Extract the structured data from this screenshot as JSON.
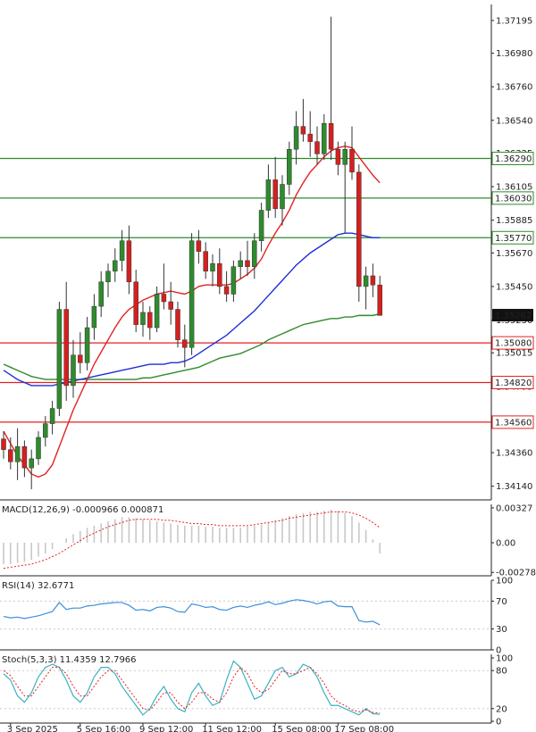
{
  "chart_data": {
    "type": "candlestick",
    "price_panel": {
      "y_ticks": [
        "1.37195",
        "1.36980",
        "1.36760",
        "1.36540",
        "1.36325",
        "1.36105",
        "1.35885",
        "1.35670",
        "1.35450",
        "1.35230",
        "1.35015",
        "1.34795",
        "1.34575",
        "1.34360",
        "1.34140"
      ],
      "ylim": [
        1.3405,
        1.373
      ],
      "current_price": "1.35262",
      "levels": [
        {
          "value": 1.3629,
          "label": "1.36290",
          "color": "#2e8b2e"
        },
        {
          "value": 1.3603,
          "label": "1.36030",
          "color": "#2e8b2e"
        },
        {
          "value": 1.3577,
          "label": "1.35770",
          "color": "#2e8b2e"
        },
        {
          "value": 1.3508,
          "label": "1.35080",
          "color": "#e32222"
        },
        {
          "value": 1.3482,
          "label": "1.34820",
          "color": "#e32222"
        },
        {
          "value": 1.3456,
          "label": "1.34560",
          "color": "#e32222"
        }
      ],
      "candles": [
        [
          1.3445,
          1.345,
          1.3432,
          1.3438
        ],
        [
          1.3438,
          1.3446,
          1.3425,
          1.343
        ],
        [
          1.343,
          1.3452,
          1.3418,
          1.344
        ],
        [
          1.344,
          1.3444,
          1.342,
          1.3426
        ],
        [
          1.3426,
          1.3438,
          1.3412,
          1.3432
        ],
        [
          1.3432,
          1.345,
          1.3428,
          1.3446
        ],
        [
          1.3446,
          1.346,
          1.344,
          1.3455
        ],
        [
          1.3455,
          1.347,
          1.3448,
          1.3465
        ],
        [
          1.3465,
          1.3535,
          1.346,
          1.353
        ],
        [
          1.353,
          1.3548,
          1.347,
          1.348
        ],
        [
          1.348,
          1.351,
          1.3472,
          1.35
        ],
        [
          1.35,
          1.3515,
          1.3488,
          1.3495
        ],
        [
          1.3495,
          1.3525,
          1.349,
          1.3518
        ],
        [
          1.3518,
          1.354,
          1.351,
          1.3532
        ],
        [
          1.3532,
          1.3555,
          1.3525,
          1.3548
        ],
        [
          1.3548,
          1.356,
          1.3538,
          1.3555
        ],
        [
          1.3555,
          1.357,
          1.3548,
          1.3562
        ],
        [
          1.3562,
          1.3582,
          1.3555,
          1.3575
        ],
        [
          1.3575,
          1.3585,
          1.354,
          1.3548
        ],
        [
          1.3548,
          1.3556,
          1.3515,
          1.352
        ],
        [
          1.352,
          1.3535,
          1.3512,
          1.3528
        ],
        [
          1.3528,
          1.3532,
          1.351,
          1.3518
        ],
        [
          1.3518,
          1.3545,
          1.3515,
          1.354
        ],
        [
          1.354,
          1.356,
          1.353,
          1.3535
        ],
        [
          1.3535,
          1.3548,
          1.352,
          1.353
        ],
        [
          1.353,
          1.3535,
          1.3505,
          1.351
        ],
        [
          1.351,
          1.352,
          1.3492,
          1.3505
        ],
        [
          1.3505,
          1.358,
          1.35,
          1.3575
        ],
        [
          1.3575,
          1.3582,
          1.356,
          1.3568
        ],
        [
          1.3568,
          1.3574,
          1.355,
          1.3555
        ],
        [
          1.3555,
          1.3566,
          1.3545,
          1.356
        ],
        [
          1.356,
          1.357,
          1.354,
          1.3545
        ],
        [
          1.3545,
          1.3555,
          1.3535,
          1.354
        ],
        [
          1.354,
          1.3562,
          1.3535,
          1.3558
        ],
        [
          1.3558,
          1.3568,
          1.355,
          1.3562
        ],
        [
          1.3562,
          1.3575,
          1.3552,
          1.3558
        ],
        [
          1.3558,
          1.358,
          1.355,
          1.3575
        ],
        [
          1.3575,
          1.36,
          1.3568,
          1.3595
        ],
        [
          1.3595,
          1.3625,
          1.359,
          1.3615
        ],
        [
          1.3615,
          1.363,
          1.359,
          1.3596
        ],
        [
          1.3596,
          1.3618,
          1.3585,
          1.3612
        ],
        [
          1.3612,
          1.364,
          1.3605,
          1.3635
        ],
        [
          1.3635,
          1.366,
          1.3625,
          1.365
        ],
        [
          1.365,
          1.3668,
          1.364,
          1.3645
        ],
        [
          1.3645,
          1.366,
          1.363,
          1.364
        ],
        [
          1.364,
          1.365,
          1.3625,
          1.3632
        ],
        [
          1.3632,
          1.3658,
          1.3628,
          1.3652
        ],
        [
          1.3652,
          1.3722,
          1.3628,
          1.3635
        ],
        [
          1.3635,
          1.364,
          1.3618,
          1.3625
        ],
        [
          1.3625,
          1.364,
          1.358,
          1.3635
        ],
        [
          1.3635,
          1.365,
          1.3615,
          1.362
        ],
        [
          1.362,
          1.3625,
          1.3535,
          1.3545
        ],
        [
          1.3545,
          1.3558,
          1.353,
          1.3552
        ],
        [
          1.3552,
          1.356,
          1.3538,
          1.3546
        ],
        [
          1.3546,
          1.3552,
          1.3526,
          1.3526
        ]
      ],
      "sma_fast_red": [
        1.345,
        1.3442,
        1.3434,
        1.3428,
        1.3422,
        1.342,
        1.3422,
        1.3428,
        1.344,
        1.3452,
        1.3464,
        1.3474,
        1.3484,
        1.3494,
        1.3502,
        1.351,
        1.3518,
        1.3525,
        1.353,
        1.3533,
        1.3536,
        1.3538,
        1.354,
        1.3541,
        1.3542,
        1.3541,
        1.354,
        1.3542,
        1.3545,
        1.3546,
        1.3546,
        1.3546,
        1.3546,
        1.3547,
        1.355,
        1.3553,
        1.3557,
        1.3563,
        1.3572,
        1.358,
        1.3587,
        1.3595,
        1.3605,
        1.3613,
        1.362,
        1.3625,
        1.363,
        1.3634,
        1.3636,
        1.3637,
        1.3636,
        1.363,
        1.3624,
        1.3618,
        1.3613
      ],
      "sma_mid_blue": [
        1.349,
        1.3487,
        1.3484,
        1.3482,
        1.348,
        1.348,
        1.348,
        1.348,
        1.3481,
        1.3482,
        1.3483,
        1.3484,
        1.3485,
        1.3486,
        1.3487,
        1.3488,
        1.3489,
        1.349,
        1.3491,
        1.3492,
        1.3493,
        1.3494,
        1.3494,
        1.3494,
        1.3495,
        1.3495,
        1.3496,
        1.3498,
        1.3501,
        1.3504,
        1.3507,
        1.351,
        1.3513,
        1.3517,
        1.3521,
        1.3525,
        1.3529,
        1.3534,
        1.3539,
        1.3544,
        1.3549,
        1.3554,
        1.3559,
        1.3563,
        1.3567,
        1.357,
        1.3573,
        1.3576,
        1.3579,
        1.358,
        1.358,
        1.3579,
        1.3578,
        1.3577,
        1.3577
      ],
      "sma_slow_green": [
        1.3494,
        1.3492,
        1.349,
        1.3488,
        1.3486,
        1.3485,
        1.3484,
        1.3484,
        1.3484,
        1.3484,
        1.3484,
        1.3484,
        1.3484,
        1.3484,
        1.3484,
        1.3484,
        1.3484,
        1.3484,
        1.3484,
        1.3484,
        1.3485,
        1.3485,
        1.3486,
        1.3487,
        1.3488,
        1.3489,
        1.349,
        1.3491,
        1.3492,
        1.3494,
        1.3496,
        1.3498,
        1.3499,
        1.35,
        1.3501,
        1.3503,
        1.3505,
        1.3507,
        1.351,
        1.3512,
        1.3514,
        1.3516,
        1.3518,
        1.352,
        1.3521,
        1.3522,
        1.3523,
        1.3524,
        1.3524,
        1.3525,
        1.3525,
        1.3526,
        1.3526,
        1.3526,
        1.3527
      ]
    },
    "macd_panel": {
      "label": "MACD(12,26,9) -0.000966 0.000871",
      "y_ticks": [
        "0.00327",
        "0.00",
        "-0.002781"
      ],
      "ylim": [
        -0.0031,
        0.0036
      ],
      "histogram": [
        -0.002,
        -0.002,
        -0.0019,
        -0.0018,
        -0.0016,
        -0.0013,
        -0.001,
        -0.0006,
        0.0,
        0.0004,
        0.0008,
        0.0011,
        0.0014,
        0.0016,
        0.0018,
        0.002,
        0.0022,
        0.0024,
        0.0024,
        0.0023,
        0.0022,
        0.0021,
        0.002,
        0.0019,
        0.0018,
        0.0017,
        0.0016,
        0.0016,
        0.0016,
        0.0015,
        0.0015,
        0.0014,
        0.0014,
        0.0014,
        0.0014,
        0.0015,
        0.0016,
        0.0017,
        0.0019,
        0.0021,
        0.0023,
        0.0025,
        0.0027,
        0.0028,
        0.0029,
        0.0029,
        0.003,
        0.0031,
        0.003,
        0.0028,
        0.0025,
        0.0019,
        0.0012,
        0.0003,
        -0.001
      ],
      "signal": [
        -0.0024,
        -0.0023,
        -0.0022,
        -0.0021,
        -0.002,
        -0.0018,
        -0.0016,
        -0.0013,
        -0.001,
        -0.0006,
        -0.0002,
        0.0002,
        0.0006,
        0.0009,
        0.0012,
        0.0015,
        0.0017,
        0.0019,
        0.0021,
        0.0022,
        0.0022,
        0.0022,
        0.0022,
        0.0021,
        0.0021,
        0.002,
        0.0019,
        0.0018,
        0.0018,
        0.0017,
        0.0017,
        0.0016,
        0.0016,
        0.0016,
        0.0016,
        0.0016,
        0.0017,
        0.0018,
        0.0019,
        0.002,
        0.0021,
        0.0023,
        0.0024,
        0.0025,
        0.0026,
        0.0027,
        0.0028,
        0.0029,
        0.0029,
        0.0029,
        0.0028,
        0.0026,
        0.0023,
        0.0019,
        0.0014
      ]
    },
    "rsi_panel": {
      "label": "RSI(14) 32.6771",
      "y_ticks": [
        "100",
        "70",
        "30",
        "0"
      ],
      "ylim": [
        0,
        100
      ],
      "values": [
        48,
        46,
        47,
        45,
        47,
        49,
        52,
        55,
        68,
        58,
        60,
        60,
        63,
        64,
        66,
        67,
        68,
        68,
        64,
        57,
        58,
        56,
        61,
        62,
        60,
        55,
        54,
        66,
        64,
        61,
        62,
        58,
        57,
        61,
        63,
        61,
        64,
        66,
        69,
        65,
        67,
        70,
        72,
        71,
        69,
        66,
        69,
        70,
        63,
        62,
        62,
        42,
        40,
        41,
        36
      ]
    },
    "stoch_panel": {
      "label": "Stoch(5,3,3) 11.4359 12.7966",
      "y_ticks": [
        "100",
        "80",
        "20",
        "0"
      ],
      "ylim": [
        0,
        100
      ],
      "k": [
        75,
        65,
        40,
        30,
        45,
        70,
        85,
        90,
        85,
        65,
        40,
        30,
        45,
        70,
        85,
        85,
        75,
        55,
        40,
        25,
        10,
        20,
        40,
        55,
        35,
        20,
        15,
        45,
        60,
        40,
        25,
        30,
        65,
        95,
        85,
        60,
        35,
        40,
        60,
        80,
        85,
        70,
        75,
        90,
        85,
        70,
        45,
        25,
        25,
        20,
        15,
        10,
        20,
        12,
        11
      ],
      "d": [
        80,
        72,
        55,
        40,
        40,
        55,
        70,
        85,
        85,
        75,
        55,
        40,
        40,
        55,
        70,
        80,
        80,
        65,
        50,
        35,
        20,
        18,
        30,
        45,
        45,
        30,
        20,
        30,
        45,
        45,
        35,
        30,
        45,
        70,
        85,
        75,
        55,
        45,
        50,
        65,
        80,
        75,
        75,
        80,
        85,
        75,
        60,
        40,
        30,
        25,
        18,
        15,
        18,
        14,
        13
      ]
    },
    "x_labels": [
      {
        "index": 1,
        "label": "3 Sep 2025"
      },
      {
        "index": 11,
        "label": "5 Sep 16:00"
      },
      {
        "index": 20,
        "label": "9 Sep 12:00"
      },
      {
        "index": 29,
        "label": "11 Sep 12:00"
      },
      {
        "index": 39,
        "label": "15 Sep 08:00"
      },
      {
        "index": 48,
        "label": "17 Sep 08:00"
      }
    ],
    "colors": {
      "bull": "#2e8b2e",
      "bear": "#d42020",
      "sma_fast": "#e32222",
      "sma_mid": "#1f2fd6",
      "sma_slow": "#2e8b2e",
      "macd_hist": "#c8c8c8",
      "macd_signal": "#e32222",
      "rsi": "#3b8fdc",
      "stoch_k": "#3bb3c3",
      "stoch_d": "#e32222"
    }
  }
}
